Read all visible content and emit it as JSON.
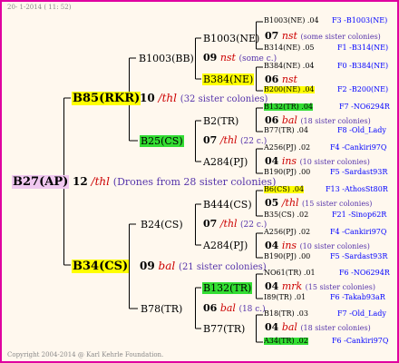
{
  "header": {
    "text": "20- 1-2014 ( 11: 52)"
  },
  "footer": {
    "text": "Copyright 2004-2014 @ Karl Kehrle Foundation."
  },
  "root": {
    "name": "B27(AP)",
    "num": "12",
    "mod": "/thl",
    "note": "(Drones from 28 sister colonies)"
  },
  "g1": {
    "top": {
      "name": "B85(RKR)",
      "num": "10",
      "mod": "/thl",
      "note": "(32 sister colonies)"
    },
    "bot": {
      "name": "B34(CS)",
      "num": "09",
      "mod": "bal",
      "note": "(21 sister colonies)"
    }
  },
  "g2": {
    "a": {
      "name": "B1003(BB)",
      "num": "09",
      "mod": "nst",
      "note": "(some c.)"
    },
    "b": {
      "name": "B25(CS)",
      "num": "07",
      "mod": "/thl",
      "note": "(22 c.)"
    },
    "c": {
      "name": "B24(CS)",
      "num": "07",
      "mod": "/thl",
      "note": "(22 c.)"
    },
    "d": {
      "name": "B78(TR)",
      "num": "06",
      "mod": "bal",
      "note": "(18 c.)"
    }
  },
  "g3": {
    "a1": "B1003(NE)",
    "a2": "B384(NE)",
    "b1": "B2(TR)",
    "b2": "A284(PJ)",
    "c1": "B444(CS)",
    "c2": "A284(PJ)",
    "d1": "B132(TR)",
    "d2": "B77(TR)"
  },
  "g4": [
    {
      "top": "B1003(NE) .04",
      "topr": "F3 -B1003(NE)",
      "num": "07",
      "mod": "nst",
      "note": "(some sister colonies)",
      "bot": "B314(NE) .05",
      "botr": "F1 -B314(NE)"
    },
    {
      "top": "B384(NE) .04",
      "topr": "F0 -B384(NE)",
      "num": "06",
      "mod": "nst",
      "note": "",
      "bot": "B200(NE) .04",
      "botr": "F2 -B200(NE)"
    },
    {
      "top": "B132(TR) .04",
      "topr": "F7 -NO6294R",
      "num": "06",
      "mod": "bal",
      "note": "(18 sister colonies)",
      "bot": "B77(TR) .04",
      "botr": "F8 -Old_Lady"
    },
    {
      "top": "A256(PJ) .02",
      "topr": "F4 -Cankiri97Q",
      "num": "04",
      "mod": "ins",
      "note": "(10 sister colonies)",
      "bot": "B190(PJ) .00",
      "botr": "F5 -Sardast93R"
    },
    {
      "top": "B6(CS) .04",
      "topr": "F13 -AthosSt80R",
      "num": "05",
      "mod": "/thl",
      "note": "(15 sister colonies)",
      "bot": "B35(CS) .02",
      "botr": "F21 -Sinop62R"
    },
    {
      "top": "A256(PJ) .02",
      "topr": "F4 -Cankiri97Q",
      "num": "04",
      "mod": "ins",
      "note": "(10 sister colonies)",
      "bot": "B190(PJ) .00",
      "botr": "F5 -Sardast93R"
    },
    {
      "top": "NO61(TR) .01",
      "topr": "F6 -NO6294R",
      "num": "04",
      "mod": "mrk",
      "note": "(15 sister colonies)",
      "bot": "I89(TR) .01",
      "botr": "F6 -Takab93aR"
    },
    {
      "top": "B18(TR) .03",
      "topr": "F7 -Old_Lady",
      "num": "04",
      "mod": "bal",
      "note": "(18 sister colonies)",
      "bot": "A34(TR) .02",
      "botr": "F6 -Cankiri97Q"
    }
  ]
}
